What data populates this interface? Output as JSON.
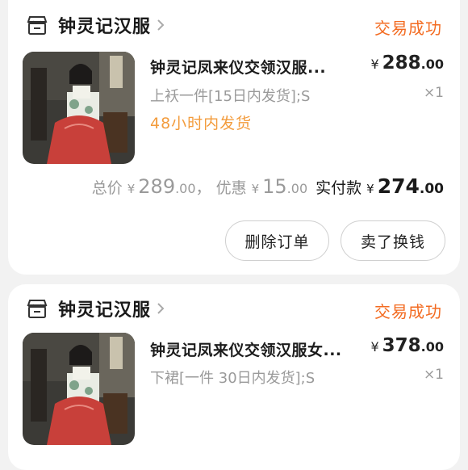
{
  "orders": [
    {
      "store": {
        "name": "钟灵记汉服",
        "icon": "store-icon"
      },
      "status": "交易成功",
      "item": {
        "title": "钟灵记凤来仪交领汉服...",
        "price_symbol": "¥",
        "price_int": "288",
        "price_dec": ".00",
        "sku": "上袄一件[15日内发货];S",
        "qty": "×1",
        "delivery": "48小时内发货"
      },
      "summary": {
        "total_label": "总价",
        "total_symbol": "¥",
        "total_int": "289",
        "total_dec": ".00",
        "separator": "，",
        "discount_label": "优惠",
        "discount_symbol": "¥",
        "discount_int": "15",
        "discount_dec": ".00",
        "paid_label": "实付款",
        "paid_symbol": "¥",
        "paid_int": "274",
        "paid_dec": ".00"
      },
      "buttons": {
        "delete": "删除订单",
        "sell": "卖了换钱"
      }
    },
    {
      "store": {
        "name": "钟灵记汉服",
        "icon": "store-icon"
      },
      "status": "交易成功",
      "item": {
        "title": "钟灵记凤来仪交领汉服女...",
        "price_symbol": "¥",
        "price_int": "378",
        "price_dec": ".00",
        "sku": "下裙[一件 30日内发货];S",
        "qty": "×1"
      }
    }
  ],
  "colors": {
    "status": "#f36b21",
    "delivery": "#f39c3d",
    "background": "#f2f2f2",
    "card": "#ffffff"
  }
}
